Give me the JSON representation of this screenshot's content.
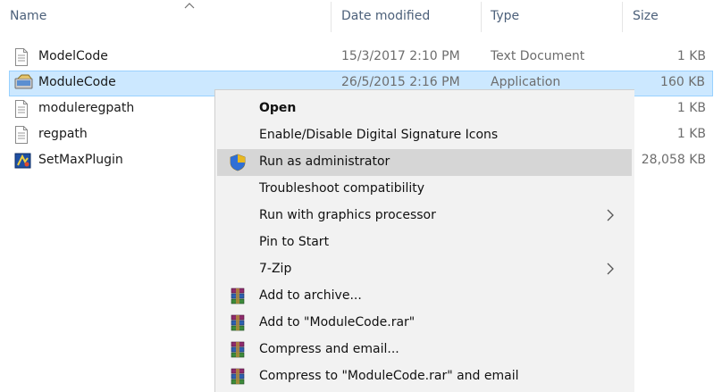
{
  "columns": {
    "name": "Name",
    "date_modified": "Date modified",
    "type": "Type",
    "size": "Size"
  },
  "files": [
    {
      "name": "ModelCode",
      "date": "15/3/2017 2:10 PM",
      "type": "Text Document",
      "size": "1 KB",
      "icon": "text-document-icon"
    },
    {
      "name": "ModuleCode",
      "date": "26/5/2015 2:16 PM",
      "type": "Application",
      "size": "160 KB",
      "icon": "application-icon"
    },
    {
      "name": "moduleregpath",
      "date": "",
      "type": "",
      "size": "1 KB",
      "icon": "text-document-icon"
    },
    {
      "name": "regpath",
      "date": "",
      "type": "",
      "size": "1 KB",
      "icon": "text-document-icon"
    },
    {
      "name": "SetMaxPlugin",
      "date": "",
      "type": "",
      "size": "28,058 KB",
      "icon": "plugin-app-icon"
    }
  ],
  "context_menu": {
    "items": [
      {
        "label": "Open",
        "bold": true
      },
      {
        "label": "Enable/Disable Digital Signature Icons"
      },
      {
        "label": "Run as administrator",
        "icon": "uac-shield-icon",
        "highlighted": true
      },
      {
        "label": "Troubleshoot compatibility"
      },
      {
        "label": "Run with graphics processor",
        "submenu": true
      },
      {
        "label": "Pin to Start"
      },
      {
        "label": "7-Zip",
        "submenu": true
      },
      {
        "label": "Add to archive...",
        "icon": "winrar-icon"
      },
      {
        "label": "Add to \"ModuleCode.rar\"",
        "icon": "winrar-icon"
      },
      {
        "label": "Compress and email...",
        "icon": "winrar-icon"
      },
      {
        "label": "Compress to \"ModuleCode.rar\" and email",
        "icon": "winrar-icon"
      }
    ]
  },
  "colors": {
    "selection_bg": "#cce8ff",
    "selection_border": "#99d1ff",
    "menu_bg": "#f2f2f2",
    "menu_hover": "#d6d6d6",
    "header_text": "#4c607a"
  }
}
